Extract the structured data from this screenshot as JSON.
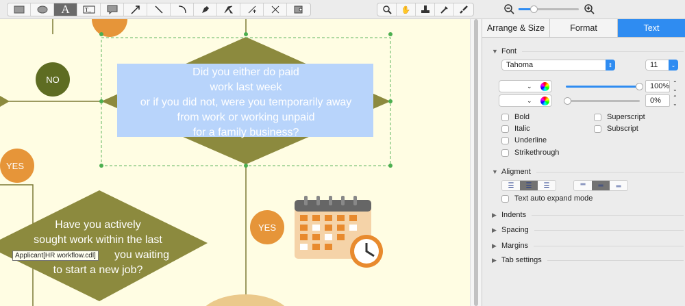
{
  "toolbar": {
    "tools": [
      "rectangle",
      "ellipse",
      "text",
      "text-box",
      "callout",
      "arrow",
      "line",
      "arc",
      "pen",
      "direct-select",
      "add-point",
      "scissors",
      "container"
    ],
    "view_tools": [
      "zoom",
      "hand",
      "stamp",
      "eyedropper",
      "brush"
    ]
  },
  "canvas": {
    "main_question": [
      "Did you either do paid",
      "work last week",
      "or if you did not, were you temporarily away",
      "from work or working unpaid",
      "for a family business?"
    ],
    "second_question": [
      "Have you actively",
      "sought work within the last",
      "you waiting",
      "to start a new job?"
    ],
    "no_label": "NO",
    "yes_label_1": "YES",
    "yes_label_2": "YES",
    "tooltip": "Applicant[HR workflow.cdl]",
    "colors": {
      "diamond": "#8c8a3e",
      "no": "#5e6c22",
      "yes": "#e69539",
      "selection": "#b8d4fb",
      "background": "#fffde3"
    }
  },
  "panel": {
    "tabs": [
      "Arrange & Size",
      "Format",
      "Text"
    ],
    "font_section": "Font",
    "font_name": "Tahoma",
    "font_size": "11",
    "opacity_1": "100%",
    "opacity_2": "0%",
    "opacity_1_value": 100,
    "opacity_2_value": 0,
    "checkboxes": {
      "bold": "Bold",
      "italic": "Italic",
      "underline": "Underline",
      "strikethrough": "Strikethrough",
      "superscript": "Superscript",
      "subscript": "Subscript"
    },
    "alignment_section": "Aligment",
    "auto_expand": "Text auto expand mode",
    "sections": [
      "Indents",
      "Spacing",
      "Margins",
      "Tab settings"
    ]
  }
}
